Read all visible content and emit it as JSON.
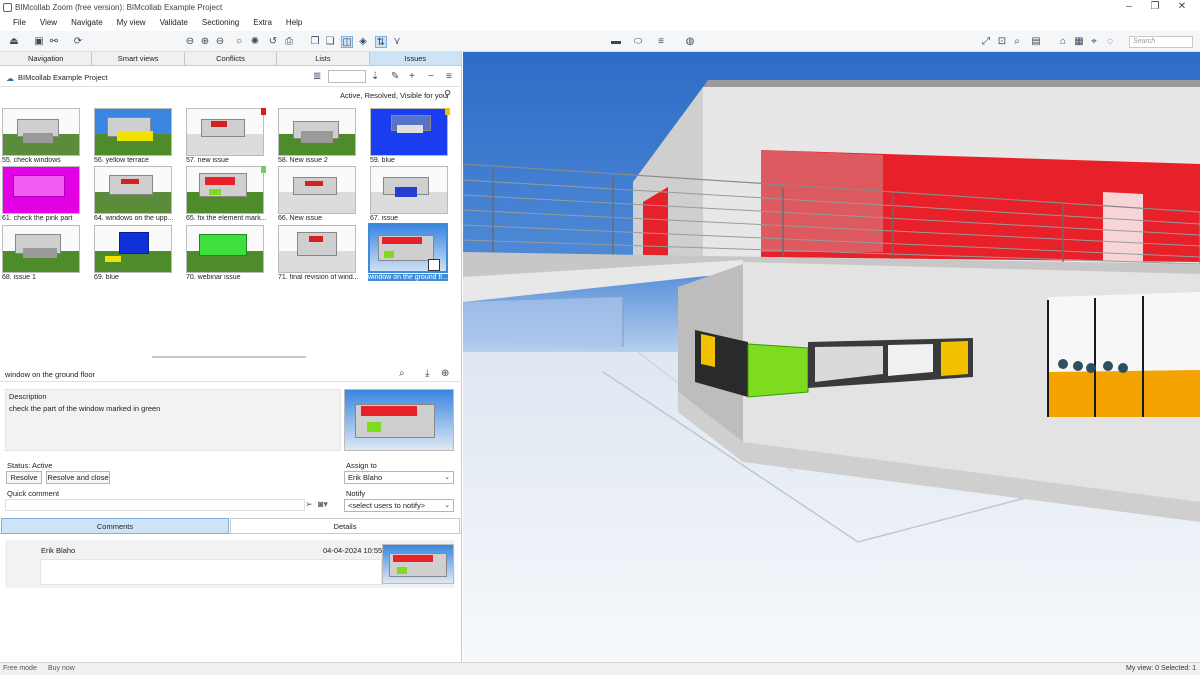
{
  "window": {
    "title": "BIMcollab Zoom (free version): BIMcollab Example Project",
    "minimize": "–",
    "maximize": "❐",
    "close": "✕"
  },
  "menu": [
    "File",
    "View",
    "Navigate",
    "My view",
    "Validate",
    "Sectioning",
    "Extra",
    "Help"
  ],
  "toolbar": {
    "search_placeholder": "Search"
  },
  "tabs": [
    "Navigation",
    "Smart views",
    "Conflicts",
    "Lists",
    "Issues"
  ],
  "active_tab": "Issues",
  "project": {
    "name": "BIMcollab Example Project"
  },
  "filter": {
    "text": "Active, Resolved, Visible for you"
  },
  "issues": [
    {
      "label": "55. check windows"
    },
    {
      "label": "56. yellow terrace"
    },
    {
      "label": "57. new issue"
    },
    {
      "label": "58. New issue 2"
    },
    {
      "label": "59. blue"
    },
    {
      "label": "61. check the pink part"
    },
    {
      "label": "64. windows on the upp..."
    },
    {
      "label": "65. fix the element mark..."
    },
    {
      "label": "66. New issue"
    },
    {
      "label": "67. issue"
    },
    {
      "label": "68. issue 1"
    },
    {
      "label": "69. blue"
    },
    {
      "label": "70. webinar issue"
    },
    {
      "label": "71. final revision of wind..."
    },
    {
      "label": "window on the ground fl..."
    }
  ],
  "issue_detail": {
    "title": "window on the ground floor",
    "description_label": "Description",
    "description": "check the part of the window marked in green",
    "status": "Status: Active",
    "resolve": "Resolve",
    "resolve_close": "Resolve and close",
    "assign_label": "Assign to",
    "assign_value": "Erik Blaho",
    "quick_comment_label": "Quick comment",
    "notify_label": "Notify",
    "notify_value": "<select users to notify>"
  },
  "comment_tabs": [
    "Comments",
    "Details"
  ],
  "comments": [
    {
      "user": "Erik Blaho",
      "date": "04-04-2024 10:55"
    }
  ],
  "statusbar": {
    "free_mode": "Free mode",
    "buy_now": "Buy now",
    "right": "My view: 0   Selected: 1"
  },
  "colors": {
    "accent": "#3d8bd9",
    "tab_active": "#cfe3f7",
    "sky": "#2f6fc4",
    "highlight_red": "#e8202a",
    "highlight_green": "#7ddc1f",
    "highlight_yellow": "#f2c200"
  }
}
